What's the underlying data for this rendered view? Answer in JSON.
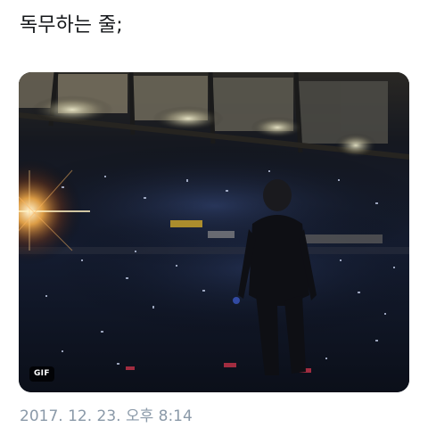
{
  "tweet": {
    "text": "독무하는 줄;",
    "timestamp": "2017. 12. 23. 오후 8:14"
  },
  "media": {
    "badge": "GIF"
  }
}
